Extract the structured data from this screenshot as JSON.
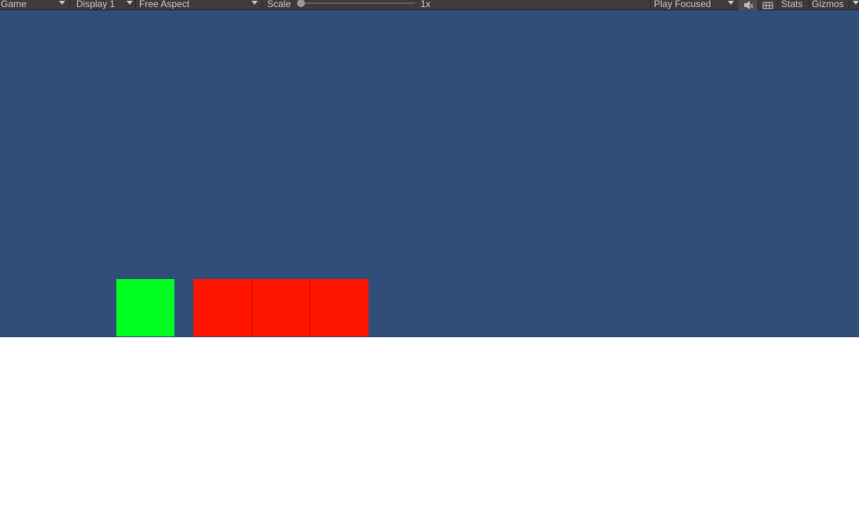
{
  "toolbar": {
    "view_label": "Game",
    "display_label": "Display 1",
    "aspect_label": "Free Aspect",
    "scale_label": "Scale",
    "scale_value": "1x",
    "play_mode_label": "Play Focused",
    "mute_icon": "mute-audio-icon",
    "stats_icon": "stats-grid-icon",
    "stats_label": "Stats",
    "gizmos_label": "Gizmos"
  },
  "game": {
    "background_color": "#314d79",
    "player": {
      "color": "#00ff21"
    },
    "obstacles": [
      {
        "color": "#ff1500"
      },
      {
        "color": "#ff1500"
      },
      {
        "color": "#ff1500"
      }
    ]
  }
}
